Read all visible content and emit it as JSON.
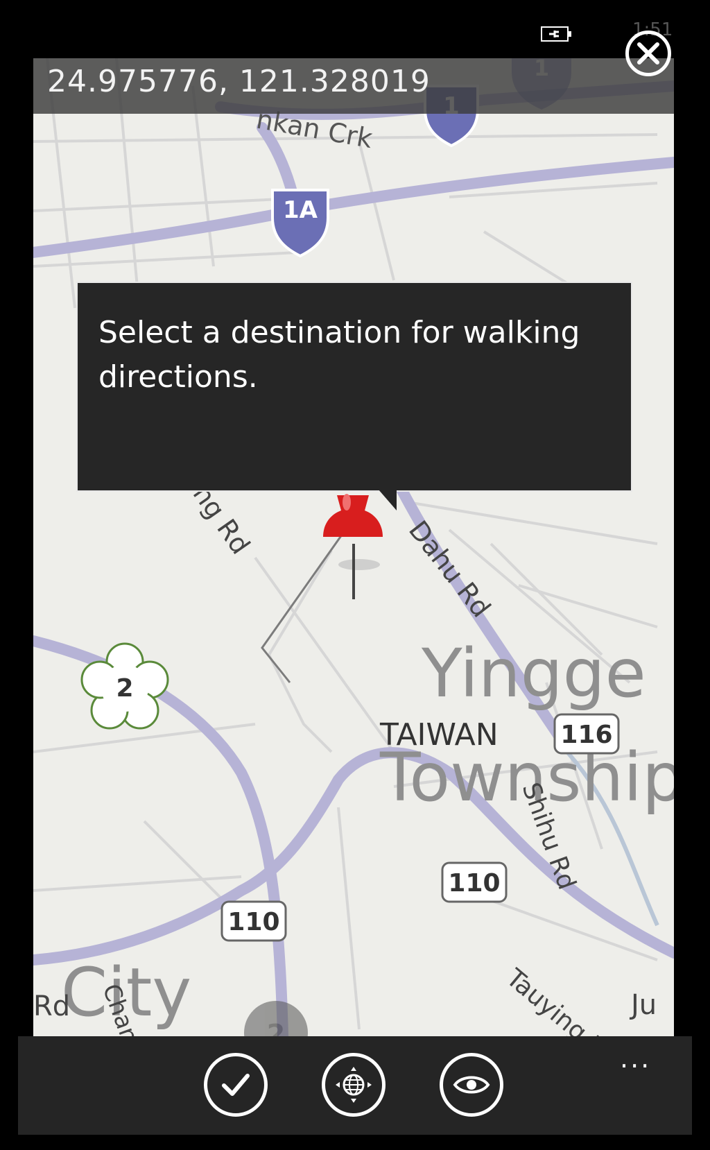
{
  "status_bar": {
    "time": "1:51",
    "battery_icon": "battery-charging-icon"
  },
  "close_button": {
    "icon": "close-icon"
  },
  "coordinates": {
    "text": "24.975776, 121.328019"
  },
  "tooltip": {
    "text": "Select a destination for walking directions."
  },
  "map": {
    "labels": {
      "creek": "nkan Crk",
      "route_1a": "1A",
      "route_1_top": "1",
      "route_1": "1",
      "route_2": "2",
      "route_2_bottom": "2",
      "route_116": "116",
      "route_110_left": "110",
      "route_110_right": "110",
      "road_ying": "ying Rd",
      "road_dahu": "Dahu Rd",
      "road_shihu": "Shihu Rd",
      "road_tauying": "Tauying R",
      "road_chang": "Chang",
      "rd_left": "Rd",
      "ju": "Ju",
      "yingge": "Yingge",
      "township": "Township",
      "taiwan": "TAIWAN",
      "city": "City"
    },
    "pin_color": "#d81e1e"
  },
  "app_bar": {
    "buttons": [
      {
        "name": "confirm-button",
        "icon": "checkmark-icon"
      },
      {
        "name": "locate-button",
        "icon": "globe-locate-icon"
      },
      {
        "name": "view-button",
        "icon": "eye-icon"
      }
    ],
    "more": "..."
  }
}
